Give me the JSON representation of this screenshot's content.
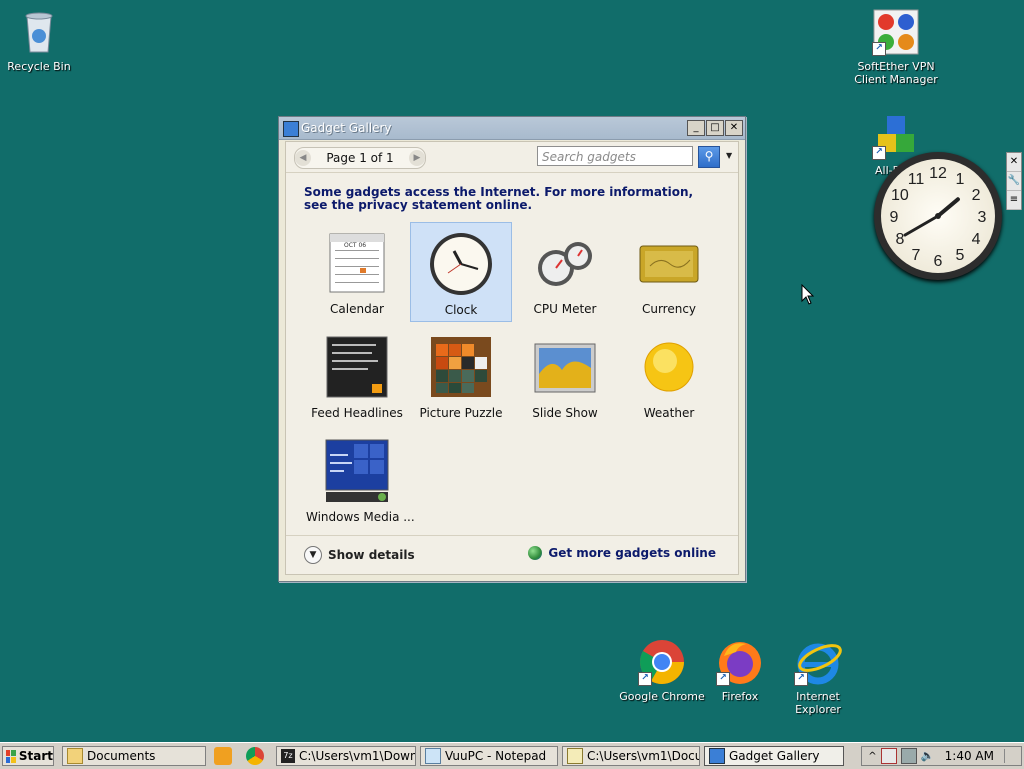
{
  "desktop": {
    "recycle_bin": "Recycle Bin",
    "softether_line1": "SoftEther VPN",
    "softether_line2": "Client Manager",
    "allp_partial": "All-P",
    "chrome": "Google Chrome",
    "firefox": "Firefox",
    "ie_line1": "Internet",
    "ie_line2": "Explorer"
  },
  "gadget_gallery": {
    "title": "Gadget Gallery",
    "page_label": "Page 1 of 1",
    "search_placeholder": "Search gadgets",
    "notice": "Some gadgets access the Internet.  For more information, see the privacy statement online.",
    "gadgets": [
      {
        "name": "Calendar",
        "selected": false
      },
      {
        "name": "Clock",
        "selected": true
      },
      {
        "name": "CPU Meter",
        "selected": false
      },
      {
        "name": "Currency",
        "selected": false
      },
      {
        "name": "Feed Headlines",
        "selected": false
      },
      {
        "name": "Picture Puzzle",
        "selected": false
      },
      {
        "name": "Slide Show",
        "selected": false
      },
      {
        "name": "Weather",
        "selected": false
      },
      {
        "name": "Windows Media ...",
        "selected": false
      }
    ],
    "calendar_month": "OCT 06",
    "show_details": "Show details",
    "get_more": "Get more gadgets online"
  },
  "clock_gadget": {
    "hours": [
      12,
      1,
      2,
      3,
      4,
      5,
      6,
      7,
      8,
      9,
      10,
      11
    ],
    "time": "1:40"
  },
  "taskbar": {
    "start": "Start",
    "buttons": [
      {
        "label": "Documents",
        "icon": "folder-icon"
      },
      {
        "label": "C:\\Users\\vm1\\Downl...",
        "icon": "7zip-icon"
      },
      {
        "label": "VuuPC  - Notepad",
        "icon": "notepad-icon"
      },
      {
        "label": "C:\\Users\\vm1\\Docu...",
        "icon": "notepad-icon"
      },
      {
        "label": "Gadget Gallery",
        "icon": "gadget-icon"
      }
    ],
    "clock": "1:40 AM"
  },
  "colors": {
    "desktop": "#116d6a",
    "selection": "#cfe1f7",
    "link": "#0c1a6b"
  }
}
